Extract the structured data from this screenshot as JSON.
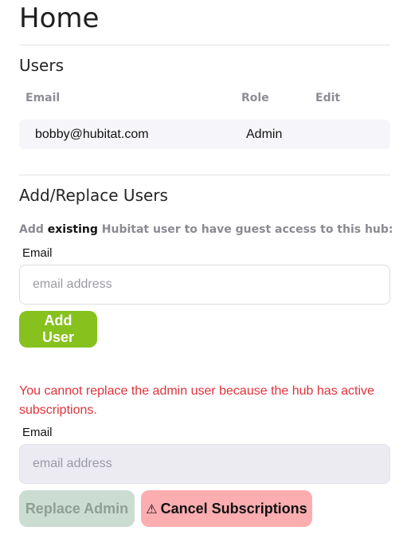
{
  "page": {
    "title": "Home"
  },
  "users_section": {
    "title": "Users",
    "columns": {
      "email": "Email",
      "role": "Role",
      "edit": "Edit"
    },
    "rows": [
      {
        "email": "bobby@hubitat.com",
        "role": "Admin",
        "edit": ""
      }
    ]
  },
  "add_section": {
    "title": "Add/Replace Users",
    "help_prefix": "Add ",
    "help_strong": "existing",
    "help_suffix": " Hubitat user to have guest access to this hub:",
    "email_label": "Email",
    "email_placeholder": "email address",
    "email_value": "",
    "add_button_label": "Add User"
  },
  "replace_section": {
    "warning": "You cannot replace the admin user because the hub has active subscriptions.",
    "email_label": "Email",
    "email_placeholder": "email address",
    "email_value": "",
    "replace_button_label": "Replace Admin",
    "cancel_button_label": "Cancel Subscriptions",
    "cancel_button_icon": "warning-icon"
  },
  "colors": {
    "add_button": "#86c11e",
    "warning_text": "#e0323b",
    "replace_button_disabled": "#cbdcd3",
    "cancel_button": "#fbadb0"
  }
}
